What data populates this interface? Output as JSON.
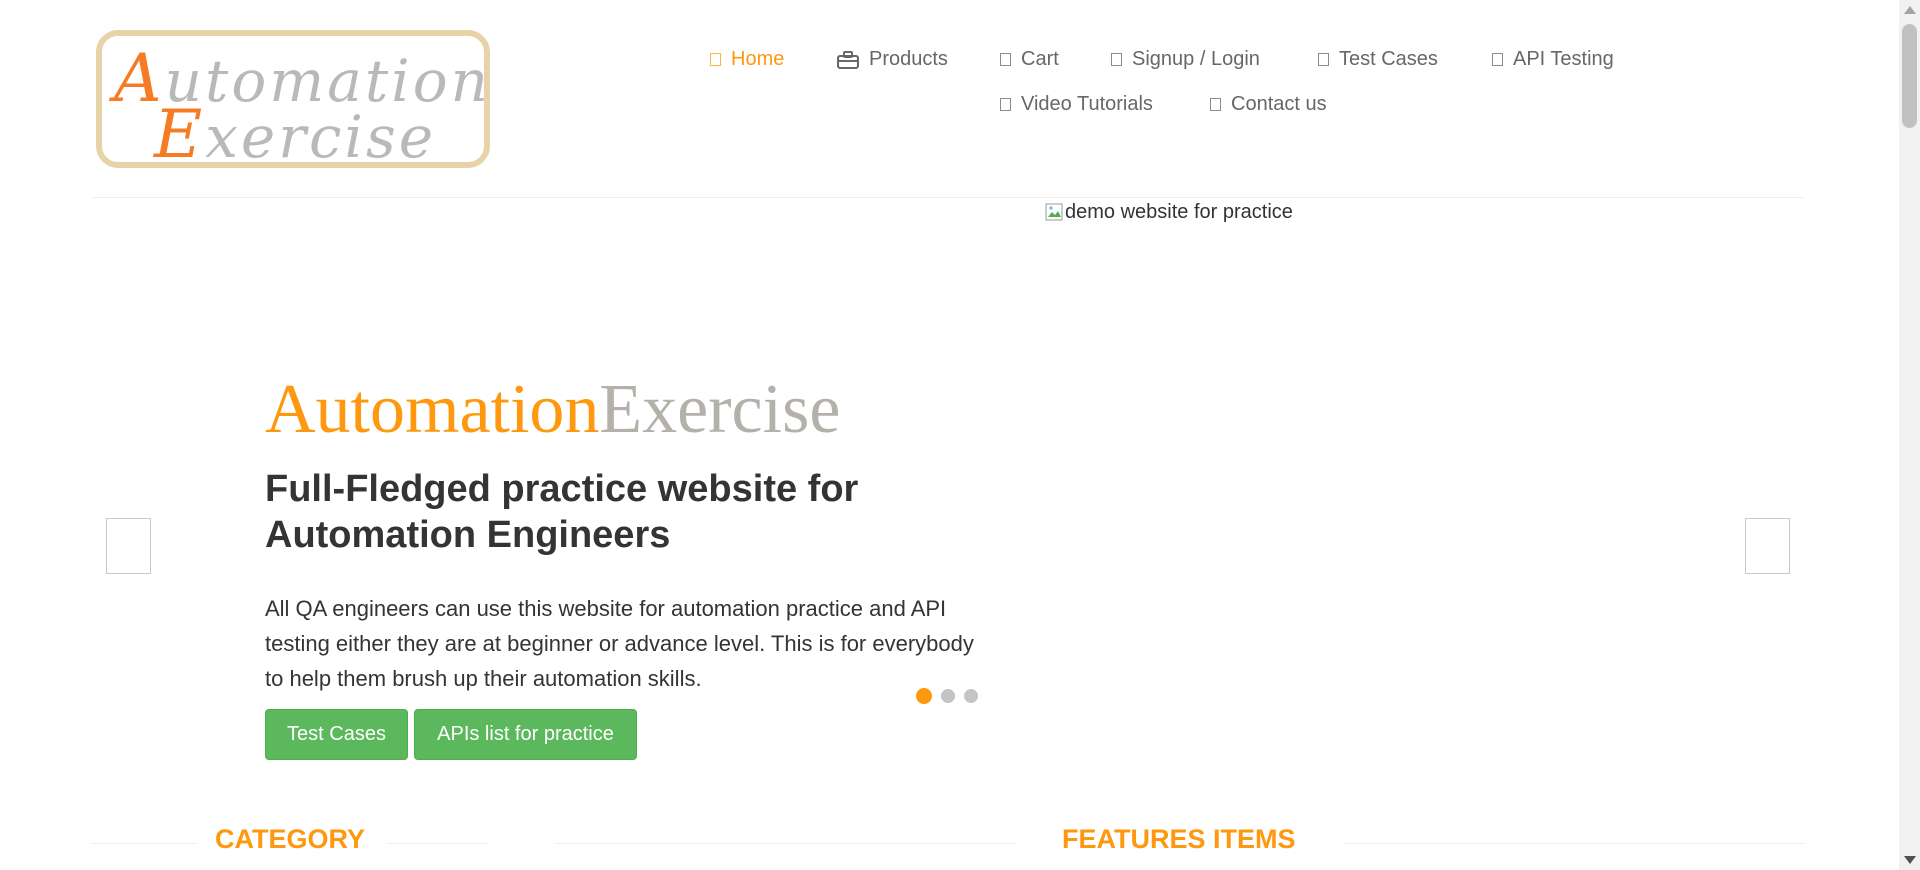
{
  "header": {
    "logo": {
      "line1_cap": "A",
      "line1_rest": "utomation",
      "line2_cap": "E",
      "line2_rest": "xercise"
    },
    "nav": [
      {
        "label": "Home",
        "icon": "home-icon",
        "active": true
      },
      {
        "label": "Products",
        "icon": "briefcase-icon",
        "active": false
      },
      {
        "label": "Cart",
        "icon": "cart-icon",
        "active": false
      },
      {
        "label": "Signup / Login",
        "icon": "lock-icon",
        "active": false
      },
      {
        "label": "Test Cases",
        "icon": "list-icon",
        "active": false
      },
      {
        "label": "API Testing",
        "icon": "list-icon",
        "active": false
      },
      {
        "label": "Video Tutorials",
        "icon": "youtube-icon",
        "active": false
      },
      {
        "label": "Contact us",
        "icon": "envelope-icon",
        "active": false
      }
    ]
  },
  "slider": {
    "image_alt": "demo website for practice",
    "title_part1": "Automation",
    "title_part2": "Exercise",
    "subtitle": "Full-Fledged practice website for Automation Engineers",
    "description": "All QA engineers can use this website for automation practice and API testing either they are at beginner or advance level. This is for everybody to help them brush up their automation skills.",
    "buttons": {
      "test_cases": "Test Cases",
      "apis": "APIs list for practice"
    },
    "active_slide": 1,
    "slide_count": 3
  },
  "sections": {
    "category": "CATEGORY",
    "features": "FEATURES ITEMS"
  },
  "colors": {
    "accent": "#fe980f",
    "button_green": "#5cb85c",
    "logo_orange": "#f57c24",
    "logo_border": "#e8d3a8"
  }
}
